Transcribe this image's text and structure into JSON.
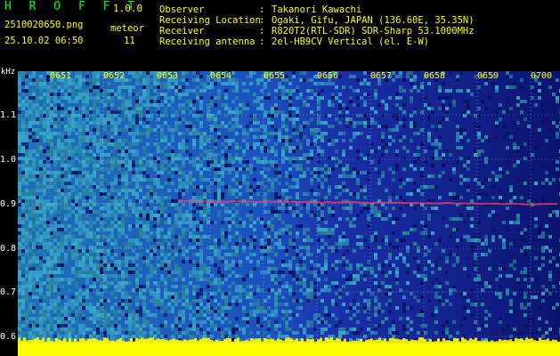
{
  "header": {
    "app_title": "H R O F F T",
    "version": "1.0.0",
    "file_name": "2510020650.png",
    "timestamp": "25.10.02 06:50",
    "meteor_label": "meteor",
    "meteor_count": "11",
    "fields": [
      {
        "label": "Observer",
        "sep": ":",
        "value": "Takanori Kawachi"
      },
      {
        "label": "Receiving Location",
        "sep": ":",
        "value": "Ogaki, Gifu, JAPAN (136.60E, 35.35N)"
      },
      {
        "label": "Receiver",
        "sep": ":",
        "value": "R820T2(RTL-SDR) SDR-Sharp 53.1000MHz"
      },
      {
        "label": "Receiving antenna",
        "sep": ":",
        "value": "2el-HB9CV Vertical (el. E-W)"
      }
    ]
  },
  "spectrogram": {
    "y_axis_unit": "kHz",
    "y_ticks": [
      "1.1",
      "1.0",
      "0.9",
      "0.8",
      "0.7",
      "0.6"
    ],
    "x_ticks": [
      "0651",
      "0652",
      "0653",
      "0654",
      "0655",
      "0656",
      "0657",
      "0658",
      "0659",
      "0700"
    ],
    "colors": {
      "noise_bright": "#3aa8c8",
      "noise_mid": "#1a3cc8",
      "noise_dark": "#0a1060",
      "yellow_band": "#ffff00",
      "grid": "#ffffff",
      "signal": "#ff4060"
    }
  }
}
